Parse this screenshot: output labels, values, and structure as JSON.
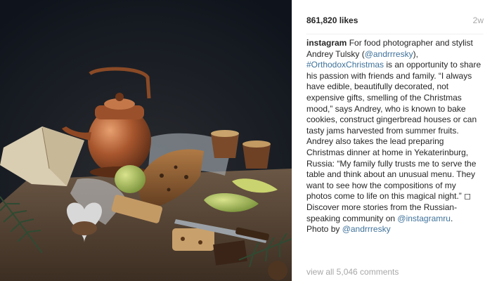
{
  "post": {
    "likes": "861,820 likes",
    "age": "2w"
  },
  "caption": {
    "username": "instagram",
    "part1": " For food photographer and stylist Andrey Tulsky (",
    "mention1": "@andrrresky",
    "part2": "),",
    "hashtag": "#OrthodoxChristmas",
    "part3": " is an opportunity to share his passion with friends and family. “I always have edible, beautifully decorated, not expensive gifts, smelling of the Christmas mood,” says Andrey, who is known to bake cookies, construct gingerbread houses or can tasty jams harvested from summer fruits. Andrey also takes the lead preparing Christmas dinner at home in Yekaterinburg, Russia: “My family fully trusts me to serve the table and think about an unusual menu. They want to see how the compositions of my photos come to life on this magical night.” ◻",
    "part4": "Discover more stories from the Russian-speaking community on ",
    "mention2": "@instagramru",
    "part5": ".",
    "part6": "Photo by ",
    "mention3": "@andrrresky"
  },
  "comments": {
    "view_all": "view all 5,046 comments"
  },
  "photo": {
    "subject": "still life: copper kettle, fruit cake loaf, pears, pine branches, open book",
    "colors": {
      "background": "#121822",
      "table": "#5a4634",
      "copper": "#b0643a",
      "cake": "#8a5a32",
      "pear": "#9fb552",
      "pine": "#2f4a32"
    }
  }
}
